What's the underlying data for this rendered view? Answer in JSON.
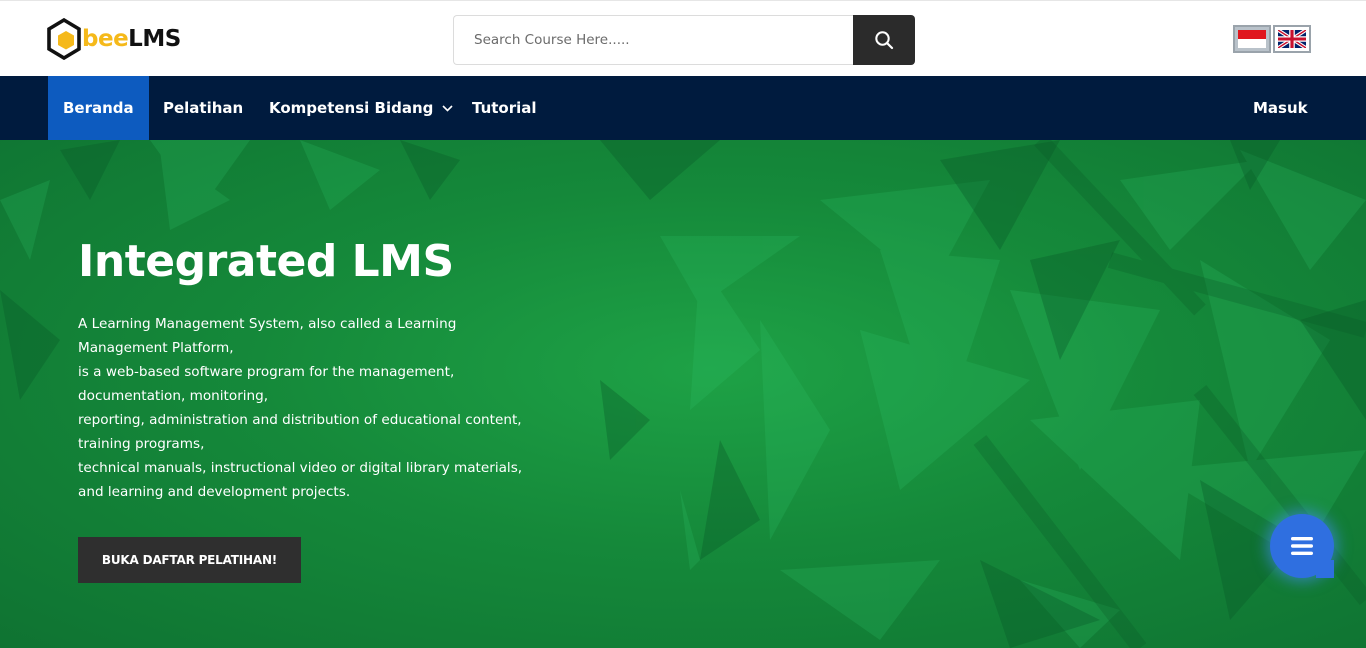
{
  "header": {
    "logo": {
      "part1": "bee",
      "part2": "LMS",
      "icon": "bee-hexagon-logo"
    },
    "search": {
      "placeholder": "Search Course Here.....",
      "value": "",
      "button_icon": "search-icon"
    },
    "languages": [
      {
        "name": "Indonesian",
        "icon": "indonesia-flag-icon",
        "active": true
      },
      {
        "name": "English",
        "icon": "uk-flag-icon",
        "active": false
      }
    ]
  },
  "nav": {
    "items": [
      {
        "label": "Beranda",
        "active": true
      },
      {
        "label": "Pelatihan"
      },
      {
        "label": "Kompetensi Bidang",
        "has_dropdown": true
      },
      {
        "label": "Tutorial"
      }
    ],
    "login_label": "Masuk"
  },
  "hero": {
    "title": "Integrated LMS",
    "description_lines": [
      "A Learning Management System, also called a Learning",
      "Management Platform,",
      "is a web-based software program for the management,",
      "documentation, monitoring,",
      "reporting, administration and distribution of educational content,",
      "training programs,",
      "technical manuals, instructional video or digital library materials,",
      "and learning and development projects."
    ],
    "cta_label": "BUKA DAFTAR PELATIHAN!"
  },
  "fab": {
    "icon": "menu-icon"
  },
  "colors": {
    "nav_background": "#001b3e",
    "nav_active": "#0d5bbf",
    "hero_green": "#15893a",
    "button_dark": "#2f2f2f",
    "logo_yellow": "#f5b91a",
    "fab_blue": "#2f6fe0"
  }
}
